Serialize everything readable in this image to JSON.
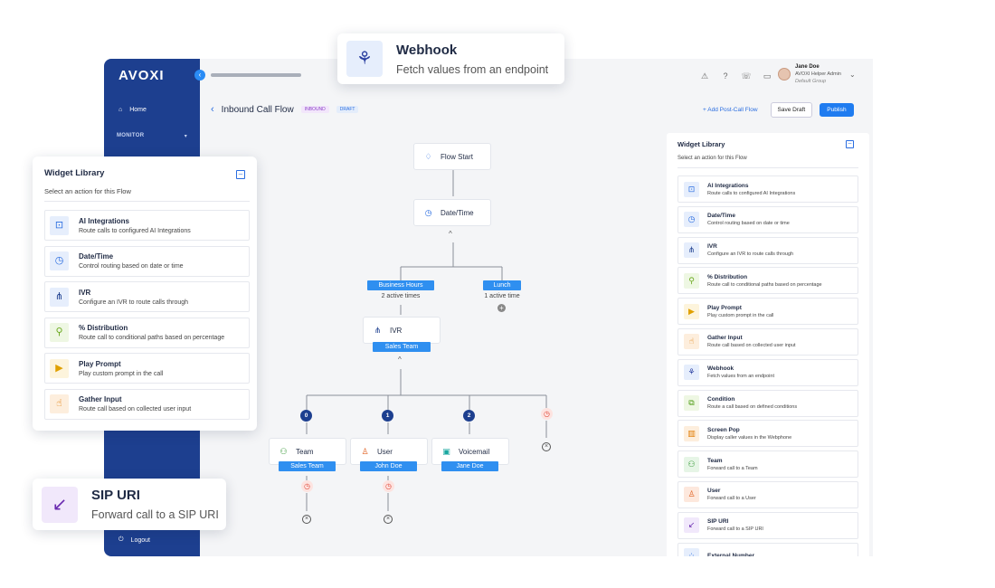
{
  "brand": "AVOXI",
  "sidebar": {
    "home": "Home",
    "monitor": "MONITOR",
    "logout": "Logout"
  },
  "user": {
    "name": "Jane Doe",
    "role": "AVOXI Helper Admin",
    "group": "Default Group"
  },
  "header": {
    "title": "Inbound Call Flow",
    "tag_inbound": "INBOUND",
    "tag_draft": "DRAFT",
    "add_post_call": "Add Post-Call Flow",
    "save_draft": "Save Draft",
    "publish": "Publish"
  },
  "flow": {
    "start": "Flow Start",
    "datetime": "Date/Time",
    "branches": [
      {
        "label": "Business Hours",
        "count": "2 active times"
      },
      {
        "label": "Lunch",
        "count": "1 active time"
      }
    ],
    "ivr": {
      "label": "IVR",
      "tag": "Sales Team"
    },
    "options": [
      {
        "num": "0",
        "label": "Team",
        "tag": "Sales Team"
      },
      {
        "num": "1",
        "label": "User",
        "tag": "John Doe"
      },
      {
        "num": "2",
        "label": "Voicemail",
        "tag": "Jane Doe"
      }
    ]
  },
  "library": {
    "title": "Widget Library",
    "subtitle": "Select an action for this Flow",
    "items": [
      {
        "name": "AI Integrations",
        "desc": "Route calls to configured AI Integrations",
        "icon": "robot-icon",
        "color": "#2a6de0",
        "bg": "#e6eefc"
      },
      {
        "name": "Date/Time",
        "desc": "Control routing based on date or time",
        "icon": "clock-icon",
        "color": "#2a6de0",
        "bg": "#e6eefc"
      },
      {
        "name": "IVR",
        "desc": "Configure an IVR to route calls through",
        "icon": "ivr-tree-icon",
        "color": "#1d3f8f",
        "bg": "#e6eefc"
      },
      {
        "name": "% Distribution",
        "desc": "Route call to conditional paths based on percentage",
        "icon": "distribution-icon",
        "color": "#6aa81e",
        "bg": "#eef7e3"
      },
      {
        "name": "Play Prompt",
        "desc": "Play custom prompt in the call",
        "icon": "play-icon",
        "color": "#e0a000",
        "bg": "#fdf4dc"
      },
      {
        "name": "Gather Input",
        "desc": "Route call based on collected user input",
        "icon": "gather-input-icon",
        "color": "#e07a00",
        "bg": "#fdeedd"
      },
      {
        "name": "Webhook",
        "desc": "Fetch values from an endpoint",
        "icon": "webhook-icon",
        "color": "#2a3fa0",
        "bg": "#e6eefc"
      },
      {
        "name": "Condition",
        "desc": "Route a call based on defined conditions",
        "icon": "condition-icon",
        "color": "#4a9a10",
        "bg": "#eef7e3"
      },
      {
        "name": "Screen Pop",
        "desc": "Display caller values in the Webphone",
        "icon": "screen-pop-icon",
        "color": "#e07a00",
        "bg": "#fdeedd"
      },
      {
        "name": "Team",
        "desc": "Forward call to a Team",
        "icon": "team-icon",
        "color": "#3a9a3a",
        "bg": "#e6f5e6"
      },
      {
        "name": "User",
        "desc": "Forward call to a User",
        "icon": "user-icon",
        "color": "#e06020",
        "bg": "#fde8dd"
      },
      {
        "name": "SIP URI",
        "desc": "Forward call to a SIP URI",
        "icon": "sip-arrow-icon",
        "color": "#6a2ab0",
        "bg": "#f1e8fb"
      },
      {
        "name": "External Number",
        "desc": "",
        "icon": "grid-dots-icon",
        "color": "#2a6de0",
        "bg": "#e6eefc"
      }
    ]
  },
  "callouts": {
    "webhook": {
      "title": "Webhook",
      "desc": "Fetch values from an endpoint",
      "icon": "webhook-icon"
    },
    "sip": {
      "title": "SIP URI",
      "desc": "Forward call to a SIP URI",
      "icon": "sip-arrow-icon"
    }
  }
}
